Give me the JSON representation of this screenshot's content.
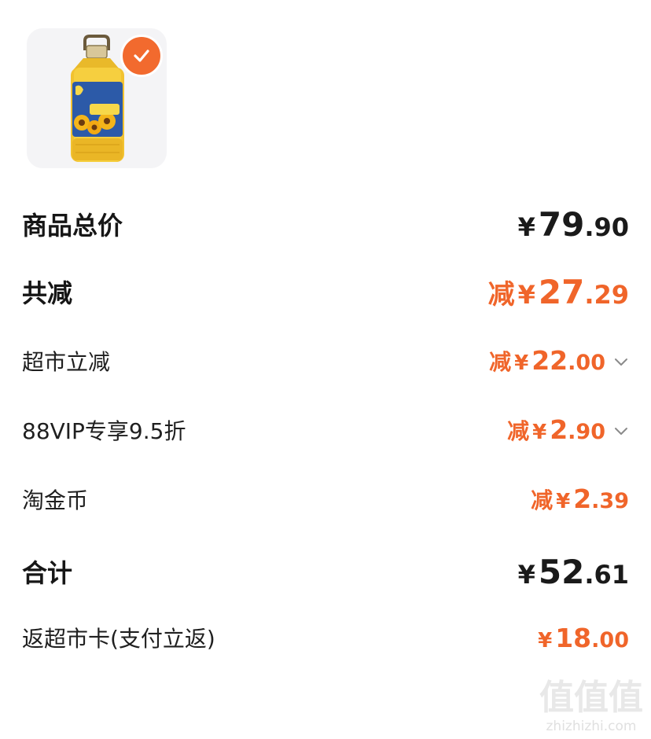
{
  "product": {
    "image_icon": "sunflower-oil-bottle",
    "selected": true
  },
  "rows": [
    {
      "label": "商品总价",
      "prefix": "",
      "currency": "¥",
      "int": "79",
      "dec": ".90"
    },
    {
      "label": "共减",
      "prefix": "减",
      "currency": "¥",
      "int": "27",
      "dec": ".29"
    },
    {
      "label": "超市立减",
      "prefix": "减",
      "currency": "¥",
      "int": "22",
      "dec": ".00"
    },
    {
      "label": "88VIP专享9.5折",
      "prefix": "减",
      "currency": "¥",
      "int": "2",
      "dec": ".90"
    },
    {
      "label": "淘金币",
      "prefix": "减",
      "currency": "¥",
      "int": "2",
      "dec": ".39"
    },
    {
      "label": "合计",
      "prefix": "",
      "currency": "¥",
      "int": "52",
      "dec": ".61"
    },
    {
      "label": "返超市卡(支付立返)",
      "prefix": "",
      "currency": "¥",
      "int": "18",
      "dec": ".00"
    }
  ],
  "colors": {
    "accent": "#f0652a",
    "text": "#1a1a1a",
    "thumb_bg": "#f4f4f6"
  },
  "watermark": {
    "logo": "值值值",
    "url": "zhizhizhi.com"
  }
}
